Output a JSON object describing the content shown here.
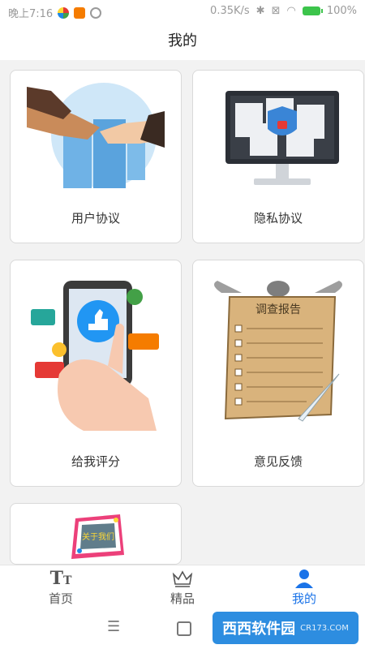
{
  "status_bar": {
    "time": "晚上7:16",
    "speed": "0.35K/s",
    "battery": "100%"
  },
  "header": {
    "title": "我的"
  },
  "cards": [
    {
      "label": "用户协议"
    },
    {
      "label": "隐私协议"
    },
    {
      "label": "给我评分"
    },
    {
      "label": "意见反馈"
    },
    {
      "label": "",
      "badge_text": "关于我们"
    }
  ],
  "survey_title": "调查报告",
  "bottom_nav": [
    {
      "label": "首页",
      "icon": "text-size-icon"
    },
    {
      "label": "精品",
      "icon": "crown-icon"
    },
    {
      "label": "我的",
      "icon": "user-icon",
      "active": true
    }
  ],
  "colors": {
    "accent": "#1a73e8",
    "background": "#f2f2f2"
  },
  "watermark": {
    "text": "西西软件园",
    "sub": "CR173.COM"
  }
}
